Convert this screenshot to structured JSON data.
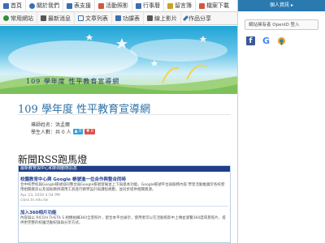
{
  "nav_top": [
    {
      "icon": "home-icon",
      "label": "首頁",
      "color": "#3a6fb0"
    },
    {
      "icon": "info-icon",
      "label": "關於我們",
      "color": "#3a6fb0"
    },
    {
      "icon": "grid-icon",
      "label": "表支援",
      "color": "#3a6fb0"
    },
    {
      "icon": "photo-icon",
      "label": "活動照影",
      "color": "#d2573b"
    },
    {
      "icon": "calendar-icon",
      "label": "行事曆",
      "color": "#3a6fb0"
    },
    {
      "icon": "book-icon",
      "label": "留言簿",
      "color": "#c8a12a"
    },
    {
      "icon": "download-icon",
      "label": "檔案下載",
      "color": "#d2573b"
    }
  ],
  "nav_second": [
    {
      "icon": "globe-icon",
      "label": "常用網站",
      "color": "#2f8f3a"
    },
    {
      "icon": "news-icon",
      "label": "最新消息",
      "color": "#555555"
    },
    {
      "icon": "doc-icon",
      "label": "文章列表",
      "color": "#3a6fb0"
    },
    {
      "icon": "table-icon",
      "label": "功課表",
      "color": "#3a6fb0"
    },
    {
      "icon": "video-icon",
      "label": "線上影片",
      "color": "#555555"
    },
    {
      "icon": "pencil-icon",
      "label": "作品分享",
      "color": "#3a6fb0"
    }
  ],
  "panel": {
    "header": "個人資訊 ▸",
    "openid_label": "網站擁有者 OpenID 登入",
    "social": [
      "facebook-icon",
      "google-icon",
      "openid-icon"
    ]
  },
  "banner": {
    "title": "109 學年度 性平教育宣導網"
  },
  "page": {
    "title": "109 學年度 性平教育宣導網",
    "teacher": "導師姓名：洪孟爾",
    "students": "學生人數：共 0 人",
    "badge_up": "0",
    "badge_down": "0"
  },
  "rss": {
    "section_title": "新聞RSS跑馬燈",
    "feed_header": "最新教育與中心和新聞動態訊息",
    "articles": [
      {
        "title": "校園教育中心與 Google 帳號進一位合作與整合同時",
        "text": "合中校學校與Google帳號協同整合與Google帳號發展並上下與基本功能。Google帳號平台與服務內容 學習活動推廣於各校使用相關資訊以及協助教師運用工具進行教學設計與課程規劃，並同步提供相關資源。",
        "date": "Apr 23, 2020 4:54 PM",
        "source": "class.tn.edu.tw"
      },
      {
        "title": "加入360相片功能",
        "text": "內容與以 RICOH THETA S 相機拍攝360全景照片，配合本平台展示，使用者可以在活動照影中上傳並瀏覽360度環景照片，提供更完整的校園活動紀錄與分享方式。",
        "date": "",
        "source": ""
      }
    ]
  }
}
